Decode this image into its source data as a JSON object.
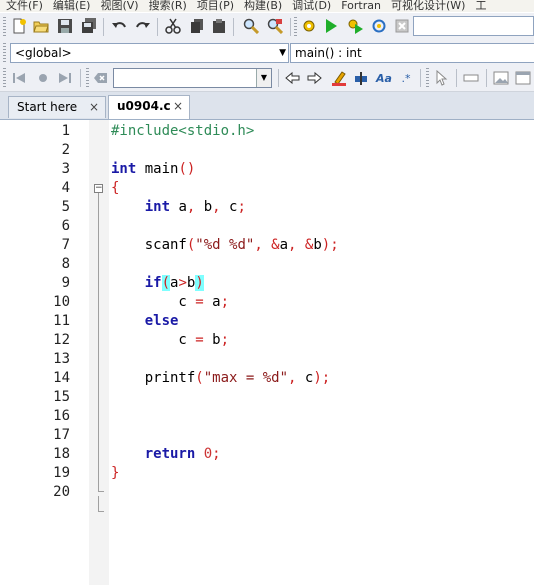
{
  "menu": [
    "文件(F)",
    "编辑(E)",
    "视图(V)",
    "搜索(R)",
    "项目(P)",
    "构建(B)",
    "调试(D)",
    "Fortran",
    "可视化设计(W)",
    "工"
  ],
  "scope": {
    "class_value": "<global>",
    "member_value": "main() : int"
  },
  "tabs": [
    {
      "label": "Start here",
      "close": "×"
    },
    {
      "label": "u0904.c",
      "close": "×"
    }
  ],
  "editor": {
    "fold_open": "−",
    "lines": [
      {
        "n": "1",
        "segments": [
          {
            "t": "#include<stdio.h>",
            "c": "pp"
          }
        ]
      },
      {
        "n": "2",
        "segments": []
      },
      {
        "n": "3",
        "segments": [
          {
            "t": "int",
            "c": "kw"
          },
          {
            "t": " main",
            "c": ""
          },
          {
            "t": "()",
            "c": "op"
          }
        ]
      },
      {
        "n": "4",
        "segments": [
          {
            "t": "{",
            "c": "brace"
          }
        ]
      },
      {
        "n": "5",
        "segments": [
          {
            "t": "    ",
            "c": ""
          },
          {
            "t": "int",
            "c": "kw"
          },
          {
            "t": " a",
            "c": ""
          },
          {
            "t": ",",
            "c": "op"
          },
          {
            "t": " b",
            "c": ""
          },
          {
            "t": ",",
            "c": "op"
          },
          {
            "t": " c",
            "c": ""
          },
          {
            "t": ";",
            "c": "op"
          }
        ]
      },
      {
        "n": "6",
        "segments": []
      },
      {
        "n": "7",
        "segments": [
          {
            "t": "    scanf",
            "c": ""
          },
          {
            "t": "(",
            "c": "op"
          },
          {
            "t": "\"%d %d\"",
            "c": "str"
          },
          {
            "t": ", &",
            "c": "op"
          },
          {
            "t": "a",
            "c": ""
          },
          {
            "t": ", &",
            "c": "op"
          },
          {
            "t": "b",
            "c": ""
          },
          {
            "t": ");",
            "c": "op"
          }
        ]
      },
      {
        "n": "8",
        "segments": []
      },
      {
        "n": "9",
        "segments": [
          {
            "t": "    ",
            "c": ""
          },
          {
            "t": "if",
            "c": "kw"
          },
          {
            "t": "(",
            "c": "op hl"
          },
          {
            "t": "a",
            "c": ""
          },
          {
            "t": ">",
            "c": "op"
          },
          {
            "t": "b",
            "c": ""
          },
          {
            "t": ")",
            "c": "op hl"
          }
        ]
      },
      {
        "n": "10",
        "segments": [
          {
            "t": "        c ",
            "c": ""
          },
          {
            "t": "=",
            "c": "op"
          },
          {
            "t": " a",
            "c": ""
          },
          {
            "t": ";",
            "c": "op"
          }
        ]
      },
      {
        "n": "11",
        "segments": [
          {
            "t": "    ",
            "c": ""
          },
          {
            "t": "else",
            "c": "kw"
          }
        ]
      },
      {
        "n": "12",
        "segments": [
          {
            "t": "        c ",
            "c": ""
          },
          {
            "t": "=",
            "c": "op"
          },
          {
            "t": " b",
            "c": ""
          },
          {
            "t": ";",
            "c": "op"
          }
        ]
      },
      {
        "n": "13",
        "segments": []
      },
      {
        "n": "14",
        "segments": [
          {
            "t": "    printf",
            "c": ""
          },
          {
            "t": "(",
            "c": "op"
          },
          {
            "t": "\"max = %d\"",
            "c": "str"
          },
          {
            "t": ",",
            "c": "op"
          },
          {
            "t": " c",
            "c": ""
          },
          {
            "t": ");",
            "c": "op"
          }
        ]
      },
      {
        "n": "15",
        "segments": []
      },
      {
        "n": "16",
        "segments": []
      },
      {
        "n": "17",
        "segments": []
      },
      {
        "n": "18",
        "segments": [
          {
            "t": "    ",
            "c": ""
          },
          {
            "t": "return",
            "c": "kw"
          },
          {
            "t": " ",
            "c": ""
          },
          {
            "t": "0",
            "c": "num"
          },
          {
            "t": ";",
            "c": "op"
          }
        ]
      },
      {
        "n": "19",
        "segments": [
          {
            "t": "}",
            "c": "brace"
          }
        ]
      },
      {
        "n": "20",
        "segments": []
      }
    ]
  },
  "colors": {
    "keyword": "#1a1aa6",
    "preprocessor": "#2e8b57",
    "string": "#8b1a1a",
    "operator": "#cc2222",
    "brace_match": "#7fffff"
  },
  "icons": [
    "new-file-icon",
    "open-icon",
    "save-icon",
    "save-all-icon",
    "undo-icon",
    "redo-icon",
    "cut-icon",
    "copy-icon",
    "paste-icon",
    "find-icon",
    "replace-icon",
    "build-icon",
    "run-icon",
    "build-run-icon",
    "rebuild-icon",
    "abort-icon"
  ]
}
